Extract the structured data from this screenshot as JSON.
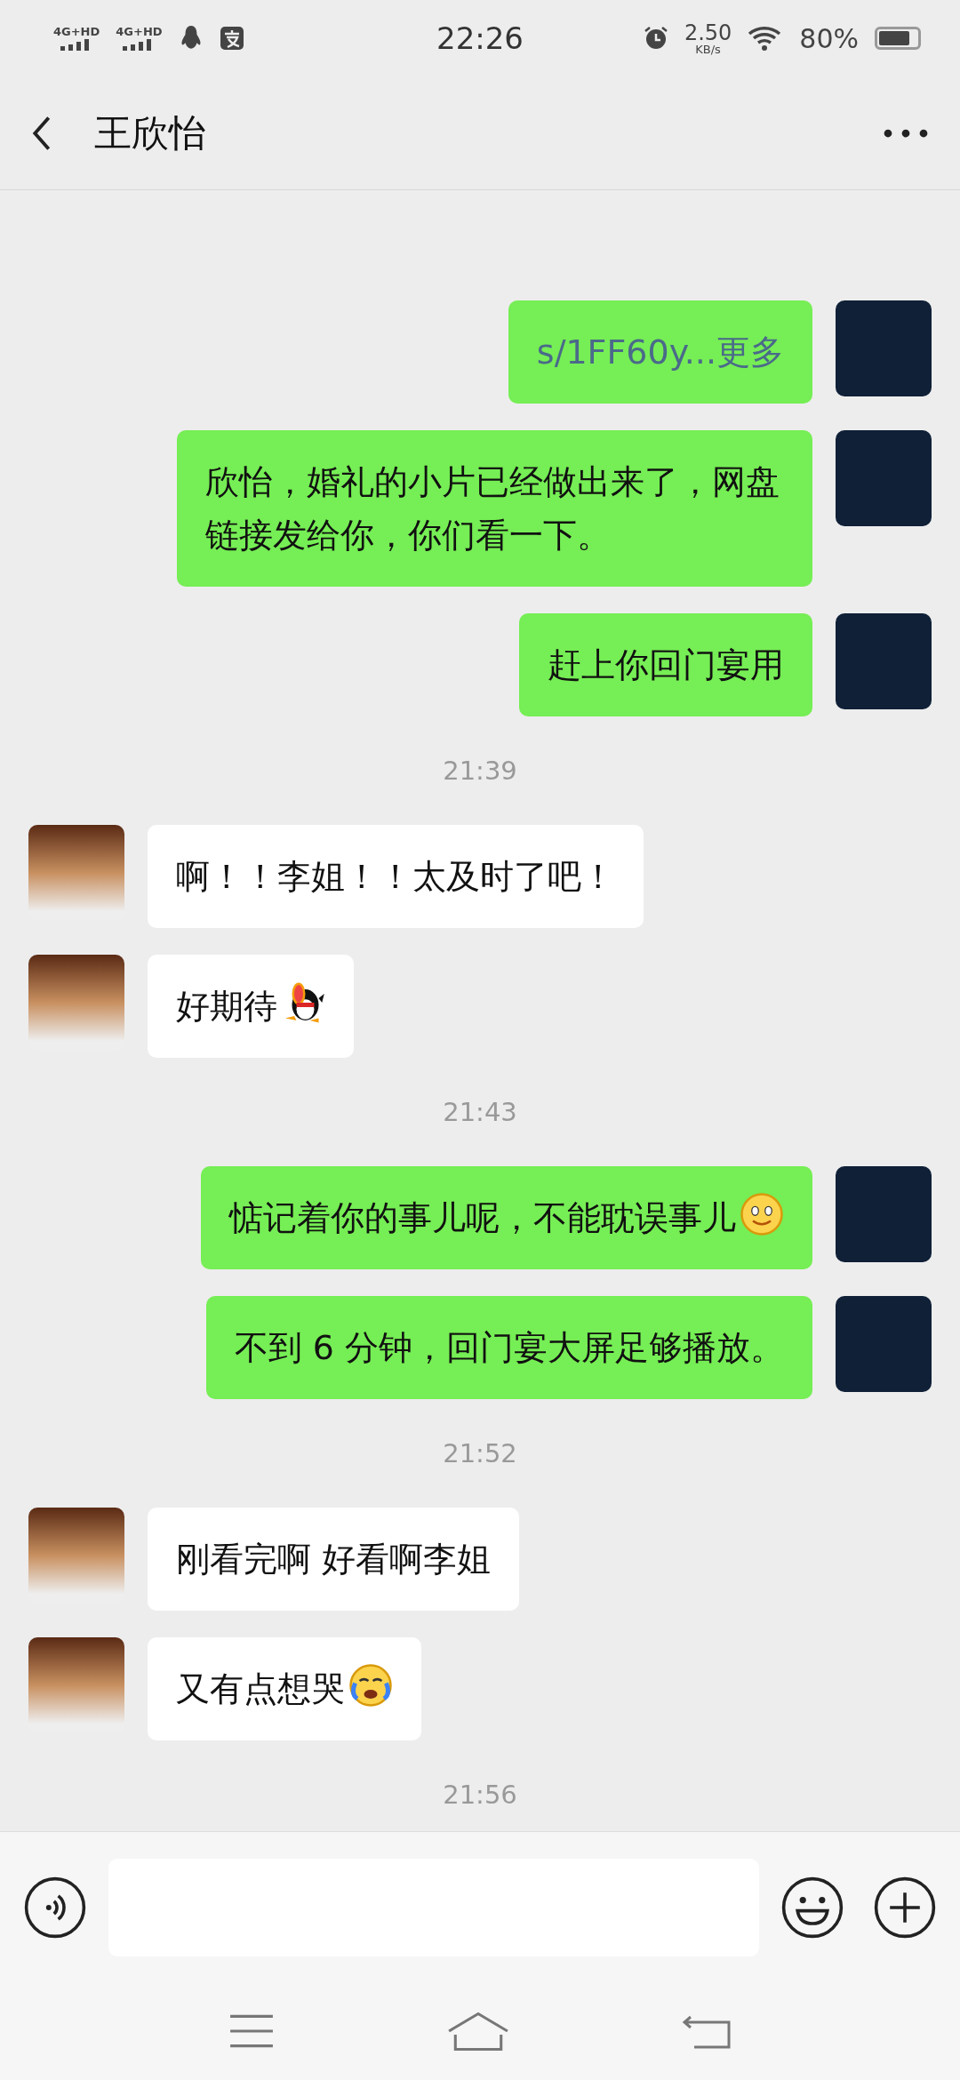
{
  "status_bar": {
    "networks": [
      "4G+HD",
      "4G+HD"
    ],
    "time": "22:26",
    "speed": "2.50",
    "speed_unit": "KB/s",
    "battery": "80%"
  },
  "header": {
    "title": "王欣怡"
  },
  "messages": [
    {
      "kind": "sent",
      "link": "s/1FF60y...更多"
    },
    {
      "kind": "sent",
      "text": "欣怡，婚礼的小片已经做出来了，网盘链接发给你，你们看一下。"
    },
    {
      "kind": "sent",
      "text": "赶上你回门宴用"
    },
    {
      "kind": "time",
      "text": "21:39"
    },
    {
      "kind": "received",
      "text": "啊！！李姐！！太及时了吧！"
    },
    {
      "kind": "received",
      "text": "好期待",
      "sticker": {
        "kind": "penguin"
      }
    },
    {
      "kind": "time",
      "text": "21:43"
    },
    {
      "kind": "sent",
      "text": "惦记着你的事儿呢，不能耽误事儿",
      "sticker": {
        "kind": "smile"
      }
    },
    {
      "kind": "sent",
      "text": "不到 6 分钟，回门宴大屏足够播放。"
    },
    {
      "kind": "time",
      "text": "21:52"
    },
    {
      "kind": "received",
      "text": "刚看完啊 好看啊李姐"
    },
    {
      "kind": "received",
      "text": "又有点想哭",
      "sticker": {
        "kind": "cry"
      }
    },
    {
      "kind": "time",
      "text": "21:56"
    }
  ]
}
